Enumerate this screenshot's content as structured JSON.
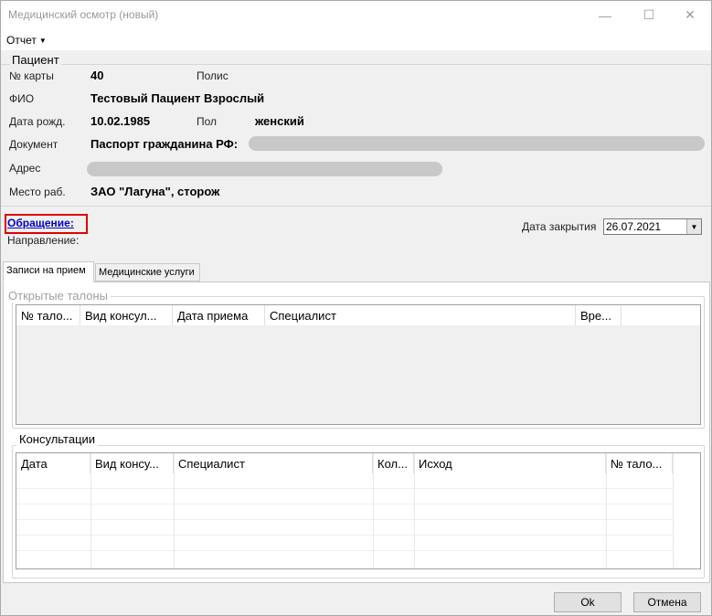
{
  "window": {
    "title": "Медицинский осмотр (новый)",
    "minimize": "—",
    "maximize": "☐",
    "close": "✕"
  },
  "menu": {
    "report": "Отчет",
    "report_arrow": "▼"
  },
  "patient": {
    "legend": "Пациент",
    "card_label": "№ карты",
    "card_value": "40",
    "policy_label": "Полис",
    "name_label": "ФИО",
    "name_value": "Тестовый Пациент Взрослый",
    "birth_label": "Дата рожд.",
    "birth_value": "10.02.1985",
    "sex_label": "Пол",
    "sex_value": "женский",
    "doc_label": "Документ",
    "doc_value": "Паспорт гражданина РФ:",
    "address_label": "Адрес",
    "work_label": "Место раб.",
    "work_value": "ЗАО \"Лагуна\", сторож"
  },
  "appeal": {
    "link": "Обращение:",
    "direction_label": "Направление:"
  },
  "close_date": {
    "label": "Дата закрытия",
    "value": "26.07.2021",
    "dropdown": "▼"
  },
  "tabs": [
    {
      "label": "Записи на прием"
    },
    {
      "label": "Медицинские услуги"
    }
  ],
  "open_tickets": {
    "legend": "Открытые талоны",
    "columns": [
      "№ тало...",
      "Вид консул...",
      "Дата приема",
      "Специалист",
      "Вре..."
    ]
  },
  "consultations": {
    "legend": "Консультации",
    "columns": [
      "Дата",
      "Вид консу...",
      "Специалист",
      "Кол...",
      "Исход",
      "№ тало..."
    ]
  },
  "buttons": {
    "ok": "Ok",
    "cancel": "Отмена"
  }
}
